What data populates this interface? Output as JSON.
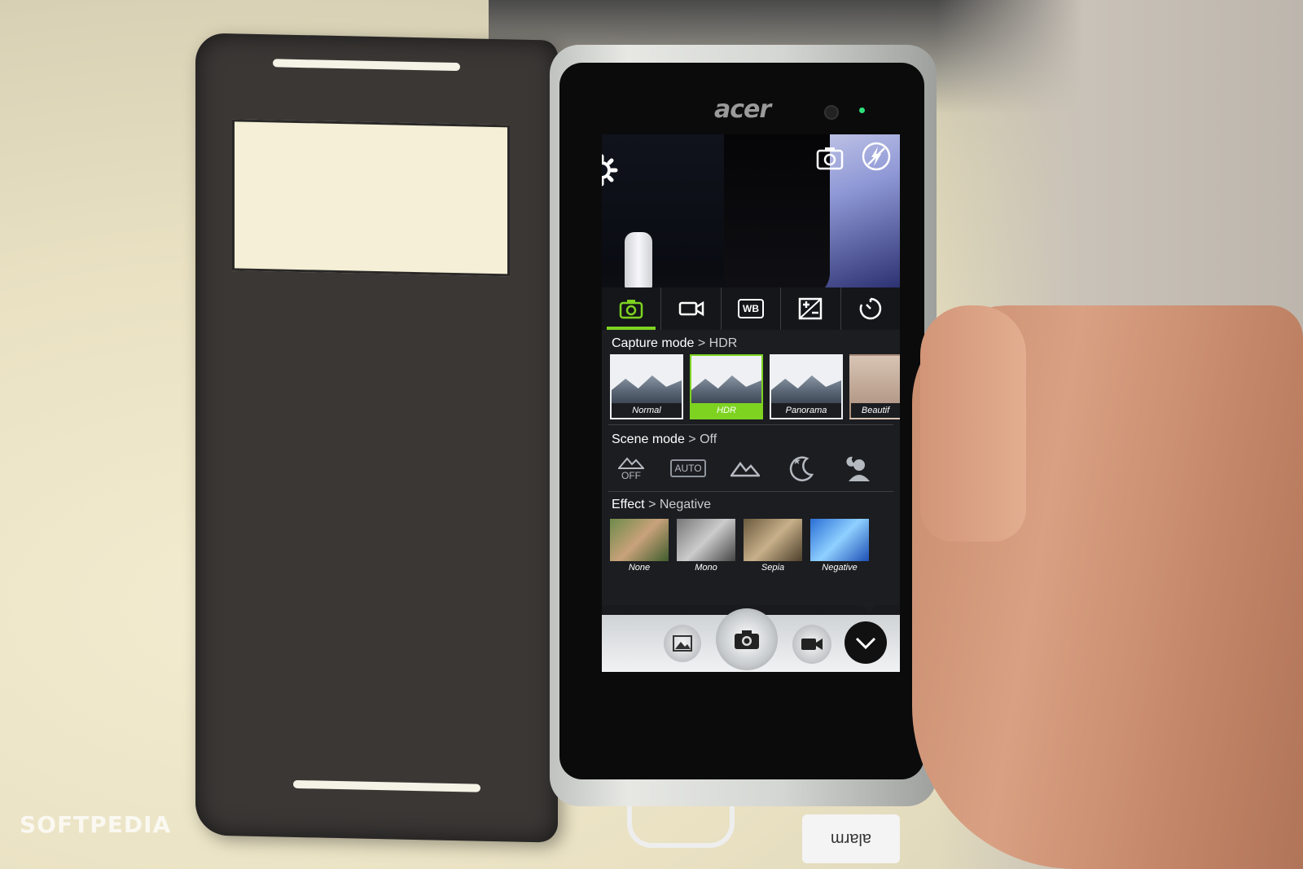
{
  "watermark": "SOFTPEDIA",
  "device": {
    "brand": "acer",
    "cable_tag": "alarm"
  },
  "camera_app": {
    "top_icons": [
      "gear-icon",
      "switch-camera-icon",
      "flash-off-icon"
    ],
    "tabs": [
      "camera-icon",
      "video-icon",
      "white-balance-icon",
      "exposure-icon",
      "timer-icon"
    ],
    "tab_wb_label": "WB",
    "capture_mode": {
      "title": "Capture mode",
      "value": "> HDR",
      "items": [
        "Normal",
        "HDR",
        "Panorama",
        "Beautif"
      ]
    },
    "scene_mode": {
      "title": "Scene mode",
      "value": "> Off",
      "off_label": "OFF",
      "auto_label": "AUTO"
    },
    "effect": {
      "title": "Effect",
      "value": "> Negative",
      "items": [
        "None",
        "Mono",
        "Sepia",
        "Negative"
      ]
    },
    "accent_color": "#7ed321"
  }
}
